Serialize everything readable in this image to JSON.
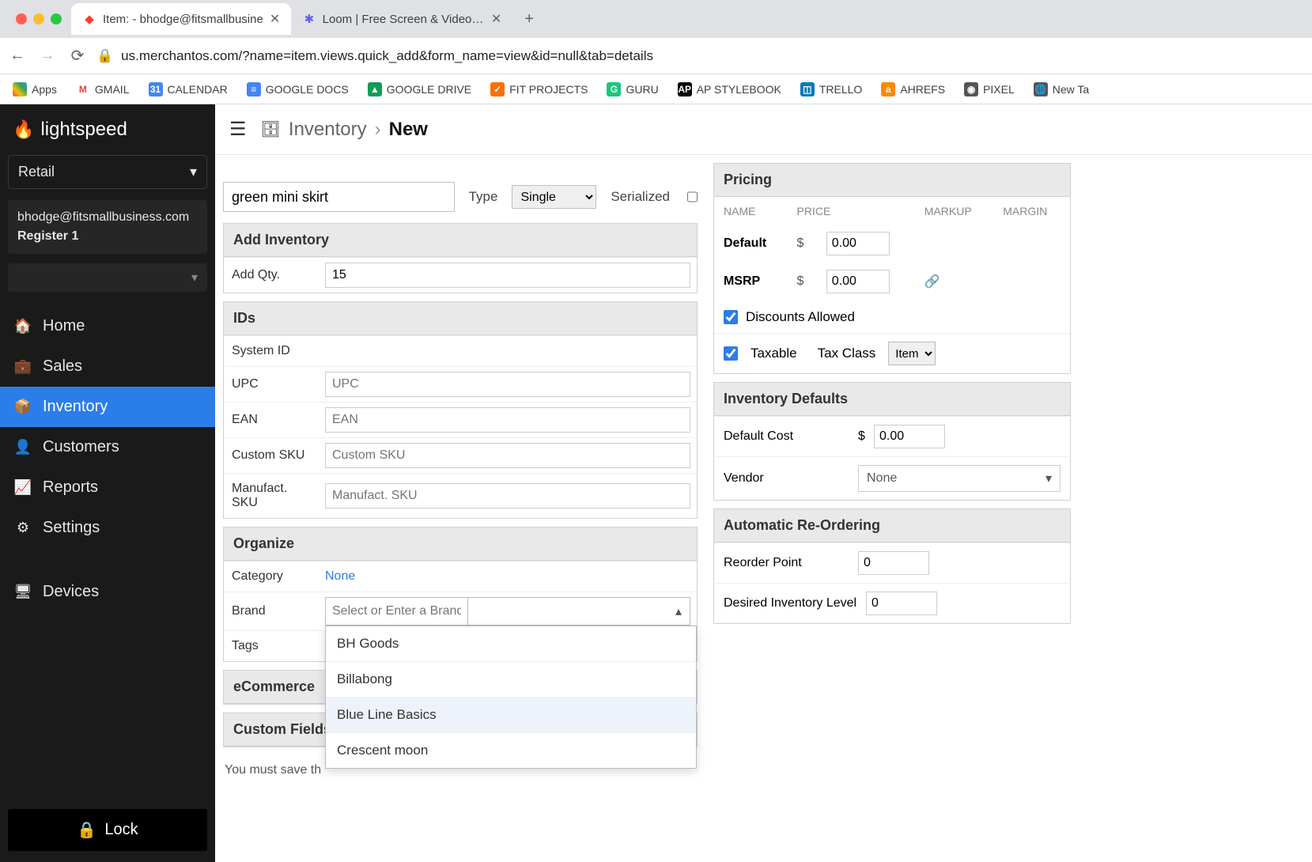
{
  "browser": {
    "tabs": [
      {
        "title": "Item: - bhodge@fitsmallbusine",
        "active": true
      },
      {
        "title": "Loom | Free Screen & Video Re",
        "active": false
      }
    ],
    "url": "us.merchantos.com/?name=item.views.quick_add&form_name=view&id=null&tab=details",
    "bookmarks": [
      "Apps",
      "GMAIL",
      "CALENDAR",
      "GOOGLE DOCS",
      "GOOGLE DRIVE",
      "FIT PROJECTS",
      "GURU",
      "AP STYLEBOOK",
      "TRELLO",
      "AHREFS",
      "PIXEL",
      "New Ta"
    ]
  },
  "sidebar": {
    "brand": "lightspeed",
    "store": "Retail",
    "user_email": "bhodge@fitsmallbusiness.com",
    "register": "Register 1",
    "items": [
      {
        "label": "Home",
        "icon": "home-icon"
      },
      {
        "label": "Sales",
        "icon": "sales-icon"
      },
      {
        "label": "Inventory",
        "icon": "inventory-icon",
        "active": true
      },
      {
        "label": "Customers",
        "icon": "customers-icon"
      },
      {
        "label": "Reports",
        "icon": "reports-icon"
      },
      {
        "label": "Settings",
        "icon": "settings-icon"
      },
      {
        "label": "Devices",
        "icon": "devices-icon"
      }
    ],
    "lock": "Lock"
  },
  "breadcrumb": {
    "section": "Inventory",
    "current": "New"
  },
  "form": {
    "item_name": "green mini skirt",
    "type_label": "Type",
    "type_value": "Single",
    "serialized_label": "Serialized",
    "serialized_checked": false,
    "add_inventory_title": "Add Inventory",
    "add_qty_label": "Add Qty.",
    "add_qty_value": "15",
    "ids_title": "IDs",
    "ids": {
      "system_id_label": "System ID",
      "system_id_value": "",
      "upc_label": "UPC",
      "upc_placeholder": "UPC",
      "ean_label": "EAN",
      "ean_placeholder": "EAN",
      "custom_sku_label": "Custom SKU",
      "custom_sku_placeholder": "Custom SKU",
      "manuf_sku_label": "Manufact. SKU",
      "manuf_sku_placeholder": "Manufact. SKU"
    },
    "organize_title": "Organize",
    "organize": {
      "category_label": "Category",
      "category_value": "None",
      "brand_label": "Brand",
      "brand_placeholder": "Select or Enter a Brand",
      "brand_options": [
        "BH Goods",
        "Billabong",
        "Blue Line Basics",
        "Crescent moon"
      ],
      "tags_label": "Tags"
    },
    "ecommerce_title": "eCommerce",
    "custom_fields_title": "Custom Fields",
    "save_note": "You must save th"
  },
  "pricing": {
    "title": "Pricing",
    "headers": {
      "name": "NAME",
      "price": "PRICE",
      "markup": "MARKUP",
      "margin": "MARGIN"
    },
    "rows": [
      {
        "name": "Default",
        "currency": "$",
        "price": "0.00"
      },
      {
        "name": "MSRP",
        "currency": "$",
        "price": "0.00",
        "link": true
      }
    ],
    "discounts_label": "Discounts Allowed",
    "discounts_checked": true,
    "taxable_label": "Taxable",
    "taxable_checked": true,
    "tax_class_label": "Tax Class",
    "tax_class_value": "Item"
  },
  "inventory_defaults": {
    "title": "Inventory Defaults",
    "default_cost_label": "Default Cost",
    "default_cost_currency": "$",
    "default_cost_value": "0.00",
    "vendor_label": "Vendor",
    "vendor_value": "None"
  },
  "reorder": {
    "title": "Automatic Re-Ordering",
    "reorder_point_label": "Reorder Point",
    "reorder_point_value": "0",
    "desired_level_label": "Desired Inventory Level",
    "desired_level_value": "0"
  }
}
